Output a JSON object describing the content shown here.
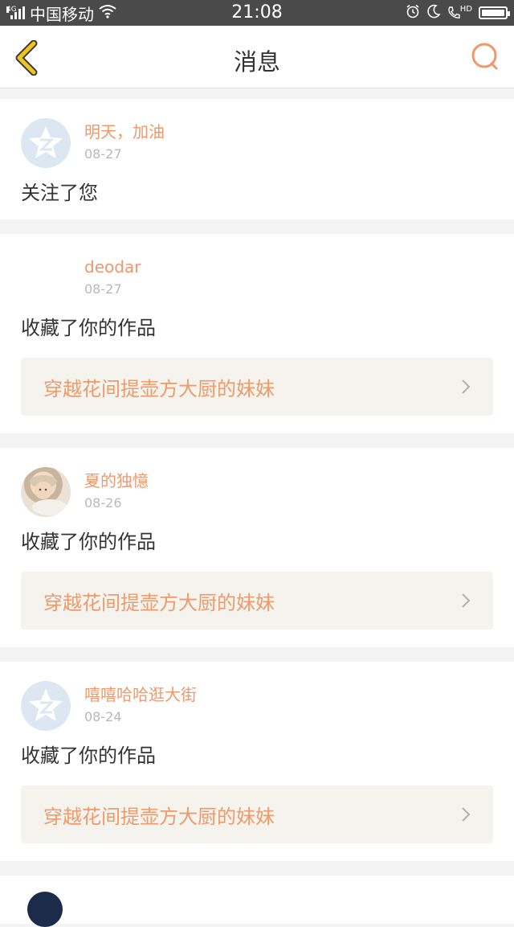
{
  "status_bar": {
    "network": "4G",
    "carrier": "中国移动",
    "time": "21:08",
    "hd": "HD"
  },
  "header": {
    "title": "消息"
  },
  "colors": {
    "accent": "#f0986b",
    "back_arrow": "#f2c318"
  },
  "notifications": [
    {
      "user": "明天，加油",
      "date": "08-27",
      "action": "关注了您",
      "avatar": "qq-default-icon"
    },
    {
      "user": "deodar",
      "date": "08-27",
      "action": "收藏了你的作品",
      "work": "穿越花间提壶方大厨的妹妹",
      "avatar": "none"
    },
    {
      "user": "夏的独憶",
      "date": "08-26",
      "action": "收藏了你的作品",
      "work": "穿越花间提壶方大厨的妹妹",
      "avatar": "baby-photo"
    },
    {
      "user": "嘻嘻哈哈逛大街",
      "date": "08-24",
      "action": "收藏了你的作品",
      "work": "穿越花间提壶方大厨的妹妹",
      "avatar": "qq-default-icon"
    }
  ]
}
